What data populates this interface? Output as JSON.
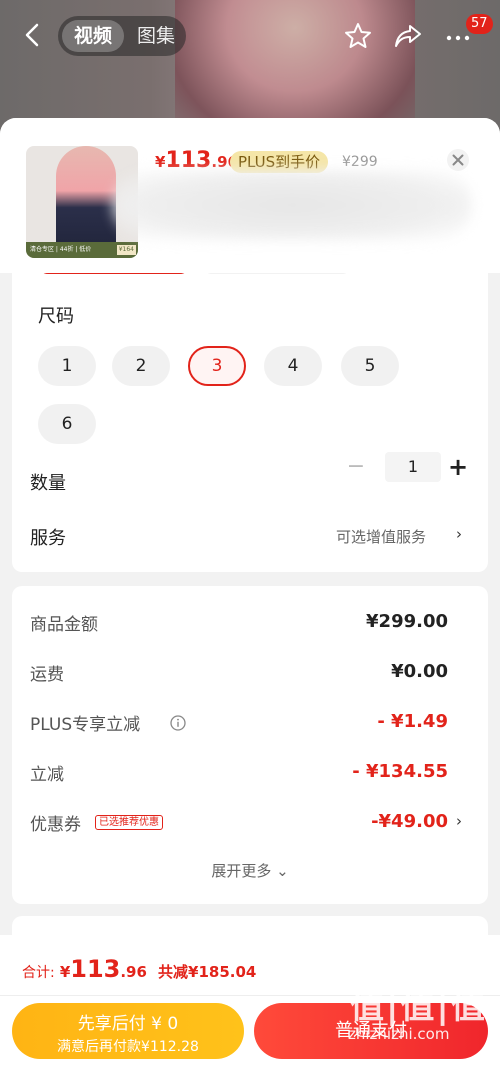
{
  "top_bar": {
    "tab_video": "视频",
    "tab_gallery": "图集",
    "cart_badge": "57"
  },
  "product": {
    "thumb_caption": "清仓专区 | 44折 | 低价",
    "thumb_sale": "¥164",
    "price_currency": "¥",
    "price_int": "113",
    "price_dec": ".96",
    "plus_tag": "PLUS到手价",
    "orig_price": "¥299"
  },
  "options": {
    "size_title": "尺码",
    "sizes": [
      "1",
      "2",
      "3",
      "4",
      "5",
      "6"
    ],
    "selected_size": "3",
    "qty_label": "数量",
    "qty_minus": "−",
    "qty_value": "1",
    "qty_plus": "+",
    "service_label": "服务",
    "service_hint": "可选增值服务",
    "chevron": "›"
  },
  "price_detail": {
    "rows": [
      {
        "label": "商品金额",
        "value": "¥299.00",
        "red": false
      },
      {
        "label": "运费",
        "value": "¥0.00",
        "red": false
      },
      {
        "label": "PLUS专享立减",
        "value": "- ¥1.49",
        "red": true
      },
      {
        "label": "立减",
        "value": "- ¥134.55",
        "red": true
      },
      {
        "label": "优惠券",
        "value": "-¥49.00",
        "red": true
      }
    ],
    "coupon_tag": "已选推荐优惠",
    "expand_more": "展开更多 ⌄"
  },
  "bottom": {
    "total_label": "合计:",
    "total_currency": "¥",
    "total_int": "113",
    "total_dec": ".96",
    "total_saved": "共减¥185.04",
    "pay_later_line1": "先享后付 ¥ 0",
    "pay_later_line2": "满意后再付款¥112.28",
    "pay_normal": "普通支付",
    "watermark_mark": "值|值|值",
    "watermark_site": "zhizhizhi.com"
  },
  "colors": {
    "accent_red": "#e2231a",
    "plus_gold": "#f5e6a8",
    "pay_later_yellow": "#ffb414"
  }
}
